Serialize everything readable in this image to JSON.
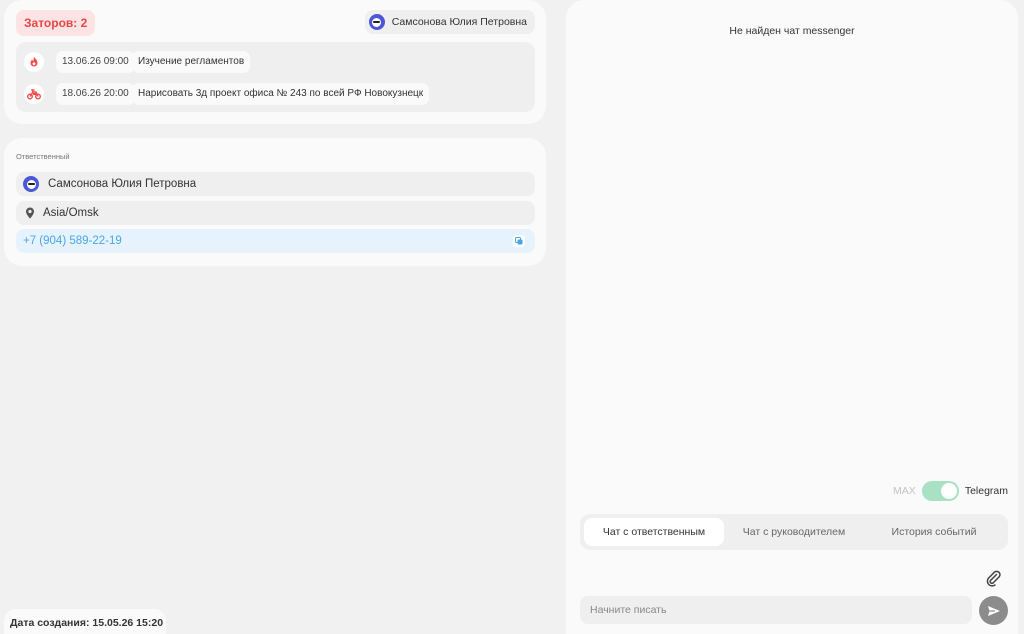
{
  "blockers": {
    "badge_label": "Заторов: 2",
    "assignee_name": "Самсонова Юлия Петровна",
    "items": [
      {
        "icon": "fire-icon",
        "date": "13.06.26 09:00",
        "title": "Изучение регламентов"
      },
      {
        "icon": "motorcycle-icon",
        "date": "18.06.26 20:00",
        "title": "Нарисовать 3д проект офиса № 243 по всей РФ Новокузнецк"
      }
    ]
  },
  "responsible": {
    "label": "Ответственный",
    "name": "Самсонова Юлия Петровна",
    "timezone": "Asia/Omsk",
    "phone": "+7 (904) 589-22-19"
  },
  "created": {
    "text": "Дата создания: 15.05.26 15:20"
  },
  "chat": {
    "empty_message": "Не найден чат messenger",
    "toggle": {
      "off_label": "MAX",
      "on_label": "Telegram",
      "state": "Telegram"
    },
    "tabs": [
      {
        "label": "Чат с ответственным",
        "active": true
      },
      {
        "label": "Чат с руководителем",
        "active": false
      },
      {
        "label": "История событий",
        "active": false
      }
    ],
    "input_placeholder": "Начните писать"
  },
  "colors": {
    "badge_bg": "#fde3e3",
    "badge_text": "#e54646",
    "avatar": "#4b57d6",
    "phone_text": "#4aa5e8",
    "phone_bg": "#e6f3fd",
    "toggle_on": "#a9e1c4",
    "send_button": "#8c8c8c"
  }
}
